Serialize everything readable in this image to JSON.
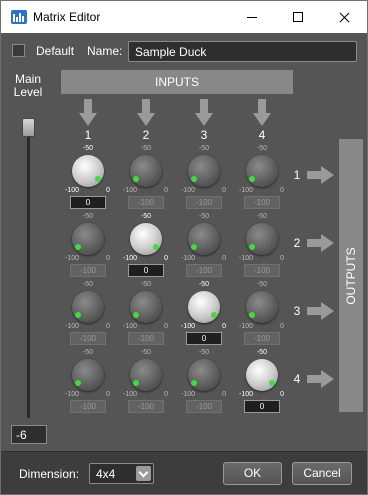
{
  "window": {
    "title": "Matrix Editor",
    "app_icon": "matrix-editor-icon",
    "buttons": [
      "minimize-icon",
      "maximize-icon",
      "close-icon"
    ]
  },
  "header": {
    "default_label": "Default",
    "default_checked": false,
    "name_label": "Name:",
    "name_value": "Sample Duck"
  },
  "main_level": {
    "label": "Main Level",
    "value": "-6"
  },
  "matrix": {
    "inputs_label": "INPUTS",
    "outputs_label": "OUTPUTS",
    "column_labels": [
      "1",
      "2",
      "3",
      "4"
    ],
    "row_labels": [
      "1",
      "2",
      "3",
      "4"
    ],
    "knob_mid_label": "-50",
    "knob_min_label": "-100",
    "knob_max_label": "0",
    "values": [
      [
        "0",
        "-100",
        "-100",
        "-100"
      ],
      [
        "-100",
        "0",
        "-100",
        "-100"
      ],
      [
        "-100",
        "-100",
        "0",
        "-100"
      ],
      [
        "-100",
        "-100",
        "-100",
        "0"
      ]
    ]
  },
  "footer": {
    "dimension_label": "Dimension:",
    "dimension_value": "4x4",
    "ok_label": "OK",
    "cancel_label": "Cancel"
  },
  "colors": {
    "background": "#555555",
    "bar": "#888888",
    "indicator_green": "#3fdc3f"
  }
}
